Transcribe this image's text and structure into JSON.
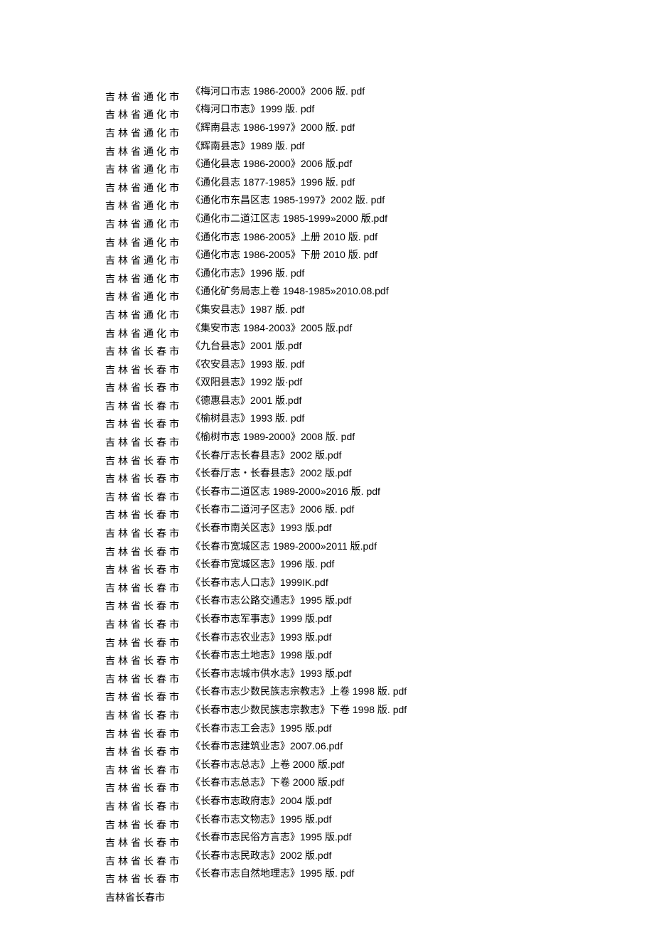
{
  "rows": [
    {
      "region": "吉林省通化市",
      "title": "《梅河口市志 1986-2000》2006 版. pdf"
    },
    {
      "region": "吉林省通化市",
      "title": "《梅河口市志》1999 版. pdf"
    },
    {
      "region": "吉林省通化市",
      "title": "《辉南县志 1986-1997》2000 版. pdf"
    },
    {
      "region": "吉林省通化市",
      "title": "《辉南县志》1989 版. pdf"
    },
    {
      "region": "吉林省通化市",
      "title": "《通化县志 1986-2000》2006 版.pdf"
    },
    {
      "region": "吉林省通化市",
      "title": "《通化县志 1877-1985》1996 版. pdf"
    },
    {
      "region": "吉林省通化市",
      "title": "《通化市东昌区志 1985-1997》2002 版. pdf"
    },
    {
      "region": "吉林省通化市",
      "title": "《通化市二道江区志 1985-1999»2000 版.pdf"
    },
    {
      "region": "吉林省通化市",
      "title": "《通化市志 1986-2005》上册 2010 版. pdf"
    },
    {
      "region": "吉林省通化市",
      "title": "《通化市志 1986-2005》下册 2010 版. pdf"
    },
    {
      "region": "吉林省通化市",
      "title": "《通化市志》1996 版. pdf"
    },
    {
      "region": "吉林省通化市",
      "title": "《通化矿务局志上卷 1948-1985»2010.08.pdf"
    },
    {
      "region": "吉林省通化市",
      "title": "《集安县志》1987 版. pdf"
    },
    {
      "region": "吉林省通化市",
      "title": "《集安市志 1984-2003》2005 版.pdf"
    },
    {
      "region": "吉林省长春市",
      "title": "《九台县志》2001 版.pdf"
    },
    {
      "region": "吉林省长春市",
      "title": "《农安县志》1993 版. pdf"
    },
    {
      "region": "吉林省长春市",
      "title": "《双阳县志》1992 版·pdf"
    },
    {
      "region": "吉林省长春市",
      "title": "《德惠县志》2001 版.pdf"
    },
    {
      "region": "吉林省长春市",
      "title": "《榆树县志》1993 版. pdf"
    },
    {
      "region": "吉林省长春市",
      "title": "《榆树市志 1989-2000》2008 版. pdf"
    },
    {
      "region": "吉林省长春市",
      "title": "《长春厅志长春县志》2002 版.pdf"
    },
    {
      "region": "吉林省长春市",
      "title": "《长春厅志・长春县志》2002 版.pdf"
    },
    {
      "region": "吉林省长春市",
      "title": "《长春市二道区志 1989-2000»2016 版. pdf"
    },
    {
      "region": "吉林省长春市",
      "title": "《长春市二道河子区志》2006 版. pdf"
    },
    {
      "region": "吉林省长春市",
      "title": "《长春市南关区志》1993 版.pdf"
    },
    {
      "region": "吉林省长春市",
      "title": "《长春市宽城区志 1989-2000»2011 版.pdf"
    },
    {
      "region": "吉林省长春市",
      "title": "《长春市宽城区志》1996 版. pdf"
    },
    {
      "region": "吉林省长春市",
      "title": "《长春市志人口志》1999IK.pdf"
    },
    {
      "region": "吉林省长春市",
      "title": "《长春市志公路交通志》1995 版.pdf"
    },
    {
      "region": "吉林省长春市",
      "title": "《长春市志军事志》1999 版.pdf"
    },
    {
      "region": "吉林省长春市",
      "title": "《长春市志农业志》1993 版.pdf"
    },
    {
      "region": "吉林省长春市",
      "title": "《长春市志土地志》1998 版.pdf"
    },
    {
      "region": "吉林省长春市",
      "title": "《长春市志城市供水志》1993 版.pdf"
    },
    {
      "region": "吉林省长春市",
      "title": "《长春市志少数民族志宗教志》上卷 1998 版. pdf"
    },
    {
      "region": "吉林省长春市",
      "title": "《长春市志少数民族志宗教志》下卷 1998 版. pdf"
    },
    {
      "region": "吉林省长春市",
      "title": "《长春市志工会志》1995 版.pdf"
    },
    {
      "region": "吉林省长春市",
      "title": "《长春市志建筑业志》2007.06.pdf"
    },
    {
      "region": "吉林省长春市",
      "title": "《长春市志总志》上卷 2000 版.pdf"
    },
    {
      "region": "吉林省长春市",
      "title": "《长春市志总志》下卷 2000 版.pdf"
    },
    {
      "region": "吉林省长春市",
      "title": "《长春市志政府志》2004 版.pdf"
    },
    {
      "region": "吉林省长春市",
      "title": "《长春市志文物志》1995 版.pdf"
    },
    {
      "region": "吉林省长春市",
      "title": "《长春市志民俗方言志》1995 版.pdf"
    },
    {
      "region": "吉林省长春市",
      "title": "《长春市志民政志》2002 版.pdf"
    },
    {
      "region": "吉林省长春市",
      "title": "《长春市志自然地理志》1995 版. pdf"
    },
    {
      "region": "吉林省长春市",
      "title": ""
    }
  ]
}
